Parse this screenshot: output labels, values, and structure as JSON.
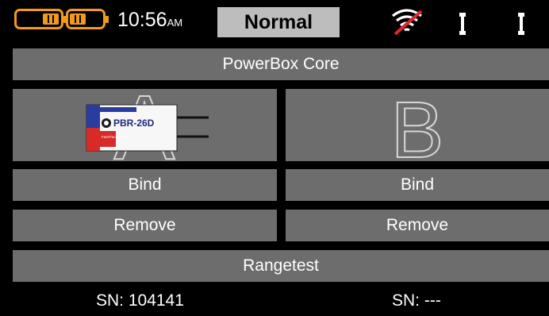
{
  "status_bar": {
    "time": "10:56",
    "time_suffix": "AM",
    "mode": "Normal",
    "battery_icon_1": "battery-pause-icon",
    "battery_icon_2": "battery-pause-icon",
    "telemetry_icon": "no-telemetry-icon",
    "antenna_icons": [
      "antenna-icon",
      "antenna-icon"
    ]
  },
  "title": "PowerBox Core",
  "slots": [
    {
      "id": "A",
      "letter": "A",
      "receiver": {
        "model": "PBR-26D",
        "label": "FastTrack/ Data"
      },
      "bind_label": "Bind",
      "remove_label": "Remove",
      "sn": "SN: 104141"
    },
    {
      "id": "B",
      "letter": "B",
      "bind_label": "Bind",
      "remove_label": "Remove",
      "sn": "SN: ---"
    }
  ],
  "rangetest_label": "Rangetest",
  "colors": {
    "accent": "#f29a1a",
    "button": "#6d6d6d",
    "mode_box": "#bdbdbd",
    "background": "#000000"
  }
}
